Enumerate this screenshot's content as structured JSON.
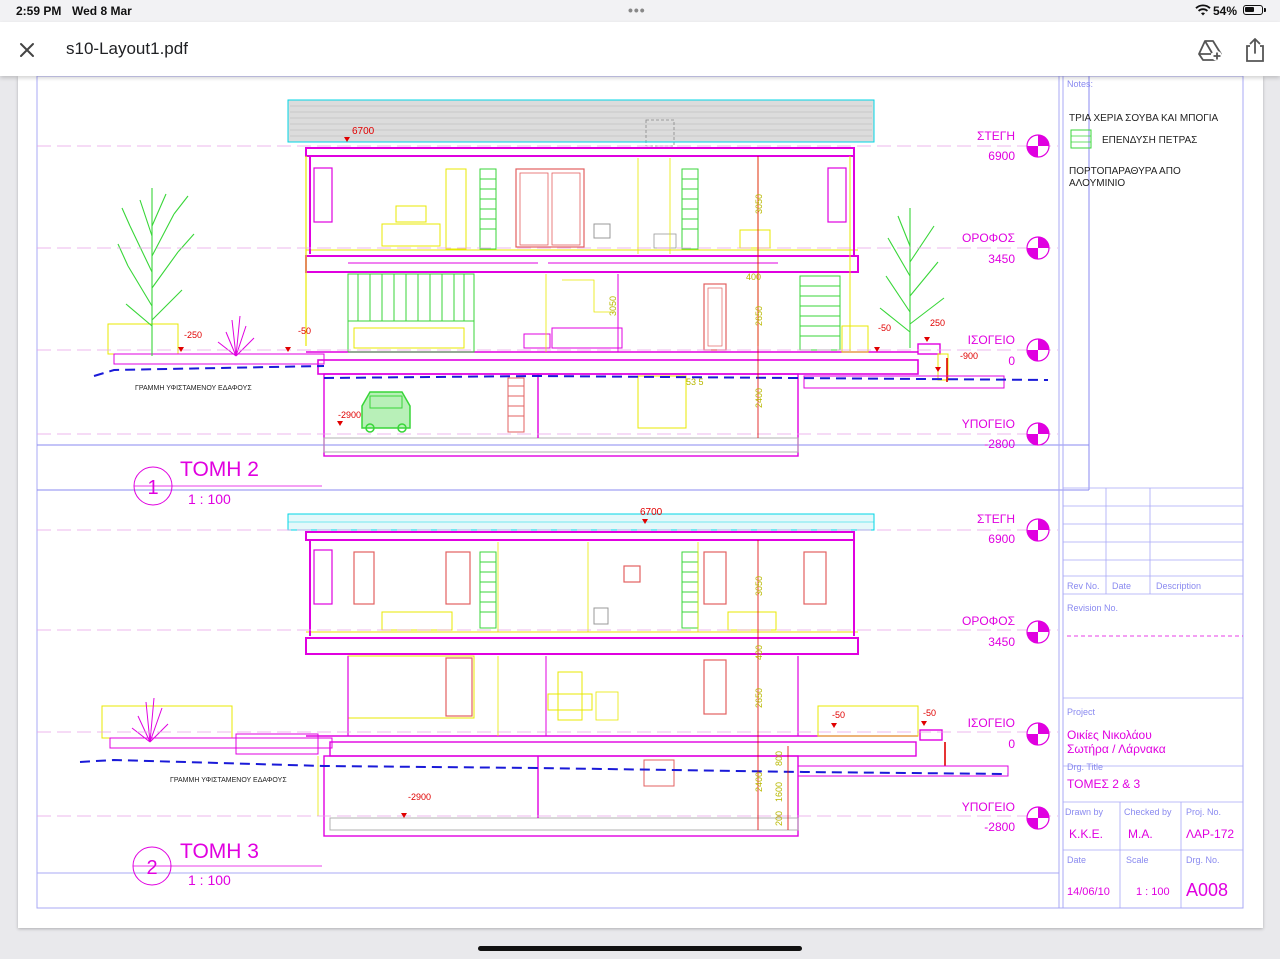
{
  "status_bar": {
    "time": "2:59 PM",
    "date": "Wed 8 Mar",
    "dots": "•••",
    "battery": "54%"
  },
  "toolbar": {
    "title": "s10-Layout1.pdf",
    "close_icon": "close-icon",
    "drive_icon": "add-to-drive-icon",
    "share_icon": "share-icon"
  },
  "colors": {
    "magenta": "#e000e0",
    "yellow": "#e8e800",
    "cyan": "#00d6e6",
    "green": "#39d639",
    "red": "#e00000",
    "blue": "#1a1ad8",
    "purple_frame": "#8a8af0",
    "olive": "#b8b800"
  },
  "drawing": {
    "levels_top": [
      {
        "name": "ΣΤΕΓΗ",
        "value": "6900"
      },
      {
        "name": "ΟΡΟΦΟΣ",
        "value": "3450"
      },
      {
        "name": "ΙΣΟΓΕΙΟ",
        "value": "0"
      },
      {
        "name": "ΥΠΟΓΕΙΟ",
        "value": "-2800"
      }
    ],
    "levels_bottom": [
      {
        "name": "ΣΤΕΓΗ",
        "value": "6900"
      },
      {
        "name": "ΟΡΟΦΟΣ",
        "value": "3450"
      },
      {
        "name": "ΙΣΟΓΕΙΟ",
        "value": "0"
      },
      {
        "name": "ΥΠΟΓΕΙΟ",
        "value": "-2800"
      }
    ],
    "section1": {
      "number": "1",
      "title": "ΤΟΜΗ 2",
      "scale": "1 : 100"
    },
    "section2": {
      "number": "2",
      "title": "ΤΟΜΗ 3",
      "scale": "1 : 100"
    },
    "ground_line_label": "ΓΡΑΜΜΗ ΥΦΙΣΤΑΜΕΝΟΥ ΕΔΑΦΟΥΣ",
    "top_dims": {
      "roof": "6700",
      "floor_h": "3050",
      "slab": "400",
      "ground_h": "2650",
      "ground_alt": "3050",
      "base_h": "2400",
      "left_a": "-250",
      "left_b": "-50",
      "right_a": "-50",
      "right_b": "250",
      "right_c": "-900",
      "basement": "-2900",
      "stair": "53 5"
    },
    "bottom_dims": {
      "roof": "6700",
      "floor_h": "3050",
      "slab": "400",
      "ground_h": "2650",
      "base_h": "2400",
      "d800": "800",
      "d1600": "1600",
      "d200": "200",
      "left": "-50",
      "right": "-50",
      "basement": "-2900"
    }
  },
  "title_block": {
    "notes_label": "Notes:",
    "note1": "ΤΡΙΑ ΧΕΡΙΑ ΣΟΥΒΑ ΚΑΙ ΜΠΟΓΙΑ",
    "note2": "ΕΠΕΝΔΥΣΗ ΠΕΤΡΑΣ",
    "note3_line1": "ΠΟΡΤΟΠΑΡΑΘΥΡΑ ΑΠΟ",
    "note3_line2": "ΑΛΟΥΜΙΝΙΟ",
    "rev_no": "Rev No.",
    "date_hdr": "Date",
    "description": "Description",
    "revision_no": "Revision No.",
    "project_label": "Project",
    "project_line1": "Οικίες Νικολάου",
    "project_line2": "Σωτήρα / Λάρνακα",
    "drg_title_label": "Drg. Title",
    "drg_title": "ΤΟΜΕΣ 2 & 3",
    "drawn_by_label": "Drawn by",
    "drawn_by": "K.K.E.",
    "checked_by_label": "Checked by",
    "checked_by": "M.A.",
    "proj_no_label": "Proj. No.",
    "proj_no": "ΛΑΡ-172",
    "date_label": "Date",
    "date": "14/06/10",
    "scale_label": "Scale",
    "scale": "1 : 100",
    "drg_no_label": "Drg. No.",
    "drg_no": "A008"
  }
}
